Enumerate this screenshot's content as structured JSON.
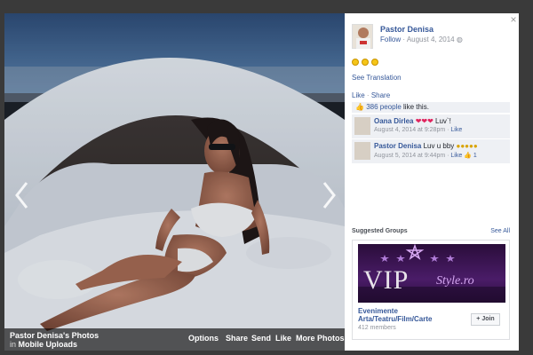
{
  "album": {
    "title": "Pastor Denisa's Photos",
    "in_label": "in",
    "source": "Mobile Uploads"
  },
  "photo_actions": [
    "Options",
    "Share",
    "Send",
    "Like",
    "More Photos"
  ],
  "post": {
    "author": "Pastor Denisa",
    "follow_label": "Follow",
    "date": "August 4, 2014",
    "emoji_count": 3,
    "see_translation": "See Translation",
    "like_label": "Like",
    "share_label": "Share",
    "likes_count": "386 people",
    "likes_suffix": " like this."
  },
  "comments": [
    {
      "author": "Oana Dirlea",
      "text_after_emoji": " Luv`!",
      "emoji": [
        "red",
        "red",
        "red"
      ],
      "time": "August 4, 2014 at 9:28pm",
      "like_label": "Like",
      "likes": ""
    },
    {
      "author": "Pastor Denisa",
      "text_after_emoji": "",
      "text": " Luv u bby",
      "emoji": [
        "yellow",
        "yellow",
        "yellow",
        "yellow",
        "yellow"
      ],
      "time": "August 5, 2014 at 9:44pm",
      "like_label": "Like",
      "likes": "1"
    }
  ],
  "suggested": {
    "heading": "Suggested Groups",
    "see_all": "See All",
    "group_name": "Evenimente Arta/Teatru/Film/Carte",
    "members": "412 members",
    "join_label": "+ Join",
    "banner_text_main": "VIP",
    "banner_text_script": "Style.ro"
  },
  "colors": {
    "link": "#365899",
    "banner_purple": "#4a1c68",
    "star": "#b07cd8"
  }
}
